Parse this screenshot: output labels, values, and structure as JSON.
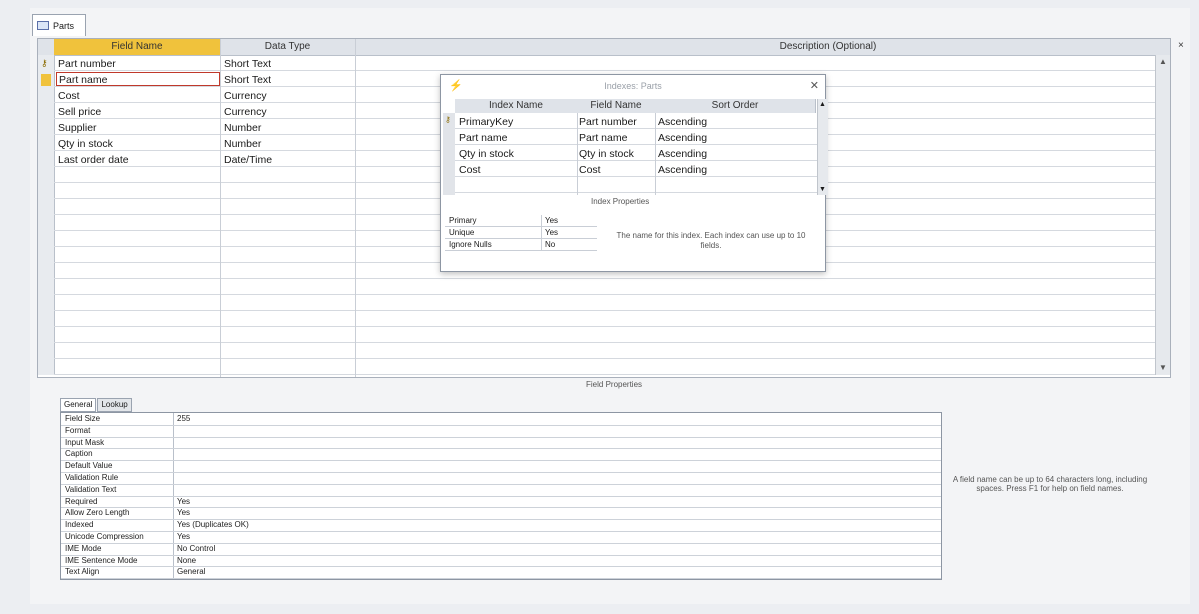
{
  "document_tab": {
    "label": "Parts"
  },
  "design_grid": {
    "headers": {
      "field_name": "Field Name",
      "data_type": "Data Type",
      "description": "Description (Optional)"
    },
    "fields": [
      {
        "name": "Part number",
        "type": "Short Text"
      },
      {
        "name": "Part name",
        "type": "Short Text"
      },
      {
        "name": "Cost",
        "type": "Currency"
      },
      {
        "name": "Sell price",
        "type": "Currency"
      },
      {
        "name": "Supplier",
        "type": "Number"
      },
      {
        "name": "Qty in stock",
        "type": "Number"
      },
      {
        "name": "Last order date",
        "type": "Date/Time"
      }
    ]
  },
  "indexes_dialog": {
    "title": "Indexes: Parts",
    "headers": {
      "index_name": "Index Name",
      "field_name": "Field Name",
      "sort_order": "Sort Order"
    },
    "rows": [
      {
        "index": "PrimaryKey",
        "field": "Part number",
        "sort": "Ascending"
      },
      {
        "index": "Part name",
        "field": "Part name",
        "sort": "Ascending"
      },
      {
        "index": "Qty in stock",
        "field": "Qty in stock",
        "sort": "Ascending"
      },
      {
        "index": "Cost",
        "field": "Cost",
        "sort": "Ascending"
      }
    ],
    "properties_title": "Index Properties",
    "properties": [
      {
        "k": "Primary",
        "v": "Yes"
      },
      {
        "k": "Unique",
        "v": "Yes"
      },
      {
        "k": "Ignore Nulls",
        "v": "No"
      }
    ],
    "help": "The name for this index. Each index can use up to 10 fields."
  },
  "field_properties": {
    "title": "Field Properties",
    "tabs": [
      "General",
      "Lookup"
    ],
    "rows": [
      {
        "k": "Field Size",
        "v": "255"
      },
      {
        "k": "Format",
        "v": ""
      },
      {
        "k": "Input Mask",
        "v": ""
      },
      {
        "k": "Caption",
        "v": ""
      },
      {
        "k": "Default Value",
        "v": ""
      },
      {
        "k": "Validation Rule",
        "v": ""
      },
      {
        "k": "Validation Text",
        "v": ""
      },
      {
        "k": "Required",
        "v": "Yes"
      },
      {
        "k": "Allow Zero Length",
        "v": "Yes"
      },
      {
        "k": "Indexed",
        "v": "Yes (Duplicates OK)"
      },
      {
        "k": "Unicode Compression",
        "v": "Yes"
      },
      {
        "k": "IME Mode",
        "v": "No Control"
      },
      {
        "k": "IME Sentence Mode",
        "v": "None"
      },
      {
        "k": "Text Align",
        "v": "General"
      }
    ],
    "help": "A field name can be up to 64 characters long, including spaces. Press F1 for help on field names."
  }
}
